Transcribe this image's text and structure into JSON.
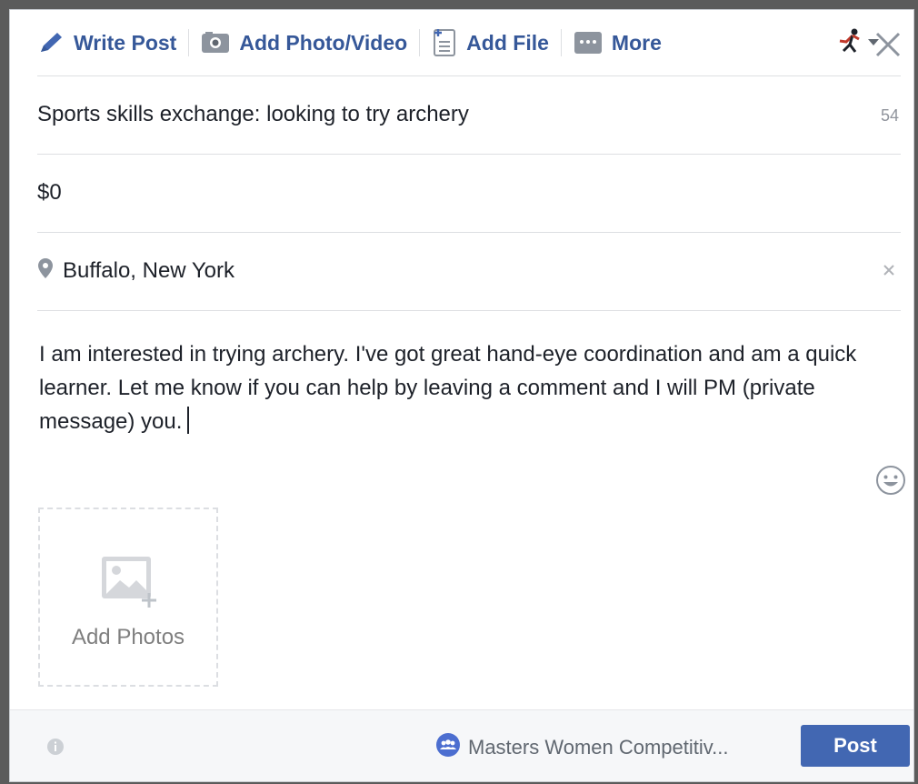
{
  "toolbar": {
    "write_post": "Write Post",
    "add_photo_video": "Add Photo/Video",
    "add_file": "Add File",
    "more": "More"
  },
  "form": {
    "title": "Sports skills exchange: looking to try archery",
    "title_counter": "54",
    "price": "$0",
    "location": "Buffalo, New York",
    "description": "I am interested in trying archery. I've got great hand-eye coordination and am a quick learner. Let me know if you can help by leaving a comment and I will PM (private message) you."
  },
  "add_photos_label": "Add Photos",
  "footer": {
    "group_name": "Masters Women Competitiv...",
    "post_label": "Post"
  },
  "icons": [
    "pencil-icon",
    "camera-icon",
    "file-icon",
    "more-icon",
    "runner-icon",
    "close-icon",
    "location-pin-icon",
    "clear-icon",
    "emoji-icon",
    "add-photo-icon",
    "info-icon",
    "group-icon"
  ],
  "colors": {
    "link": "#365899",
    "button": "#4267b2",
    "text": "#1d2129",
    "muted": "#90949c"
  }
}
